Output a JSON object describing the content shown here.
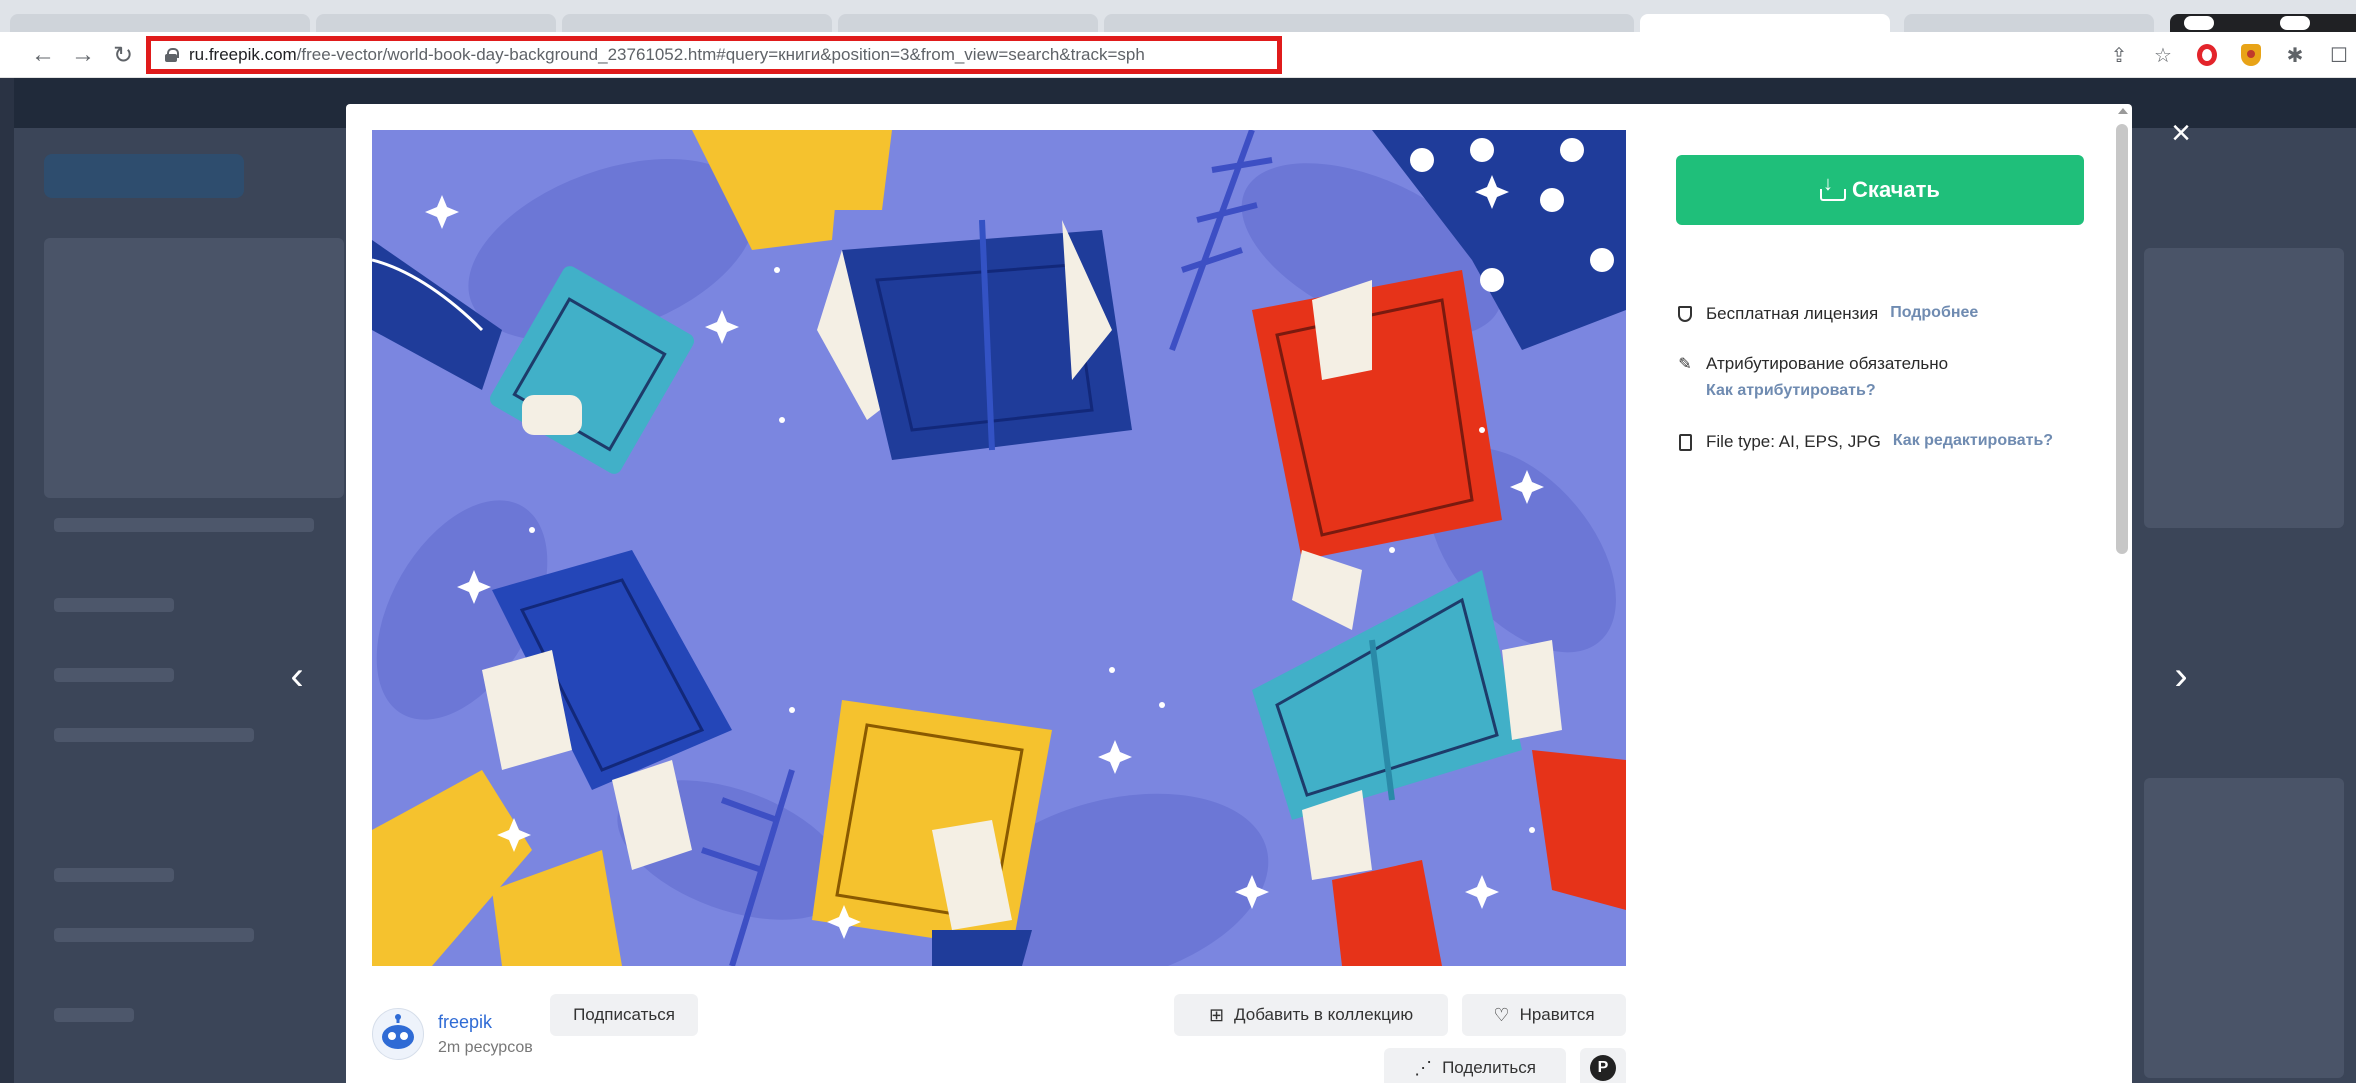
{
  "browser": {
    "url_host": "ru.freepik.com",
    "url_path": "/free-vector/world-book-day-background_23761052.htm#query=книги&position=3&from_view=search&track=sph"
  },
  "modal": {
    "download_label": "Скачать",
    "license_label": "Бесплатная лицензия",
    "license_link": "Подробнее",
    "attribution_label": "Атрибутирование обязательно",
    "attribution_link": "Как атрибутировать?",
    "filetype_label": "File type:",
    "filetype_value": "AI, EPS, JPG",
    "filetype_link": "Как редактировать?",
    "author_name": "freepik",
    "author_resources": "2m ресурсов",
    "subscribe_label": "Подписаться",
    "add_collection_label": "Добавить в коллекцию",
    "like_label": "Нравится",
    "share_label": "Поделиться"
  },
  "colors": {
    "accent_green": "#1fbf7a",
    "url_highlight": "#e01b1b",
    "illustration_bg": "#7b86e0",
    "link_blue": "#6f8bb1"
  },
  "icons": [
    "back-icon",
    "forward-icon",
    "reload-icon",
    "lock-icon",
    "share-page-icon",
    "bookmark-star-icon",
    "opera-icon",
    "ublock-icon",
    "extensions-icon",
    "close-icon",
    "chevron-left-icon",
    "chevron-right-icon",
    "download-icon",
    "shield-icon",
    "attribution-pen-icon",
    "file-icon",
    "folder-plus-icon",
    "heart-icon",
    "share-icon",
    "pinterest-icon"
  ]
}
